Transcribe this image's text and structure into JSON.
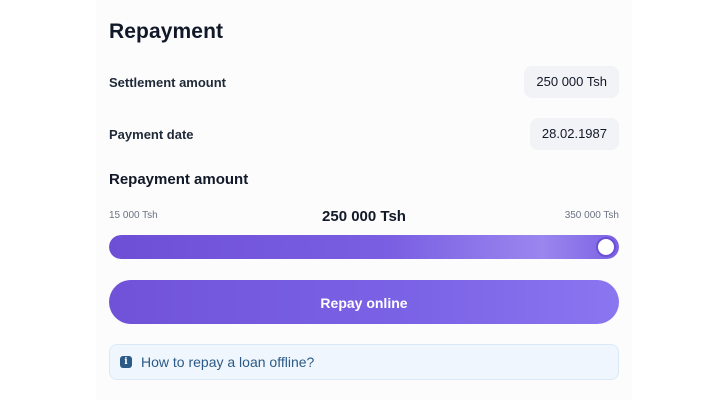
{
  "repayment": {
    "title": "Repayment",
    "settlement_label": "Settlement amount",
    "settlement_value": "250 000 Tsh",
    "payment_date_label": "Payment date",
    "payment_date_value": "28.02.1987",
    "amount_section_title": "Repayment amount"
  },
  "slider": {
    "min_label": "15 000 Tsh",
    "max_label": "350 000 Tsh",
    "current_label": "250 000 Tsh",
    "fraction": 1.0,
    "accent_color": "#6d4fd6"
  },
  "actions": {
    "repay_button_label": "Repay online",
    "offline_link_text": "How to repay a loan offline?",
    "info_icon_glyph": "i",
    "info_icon_name": "info-icon"
  }
}
